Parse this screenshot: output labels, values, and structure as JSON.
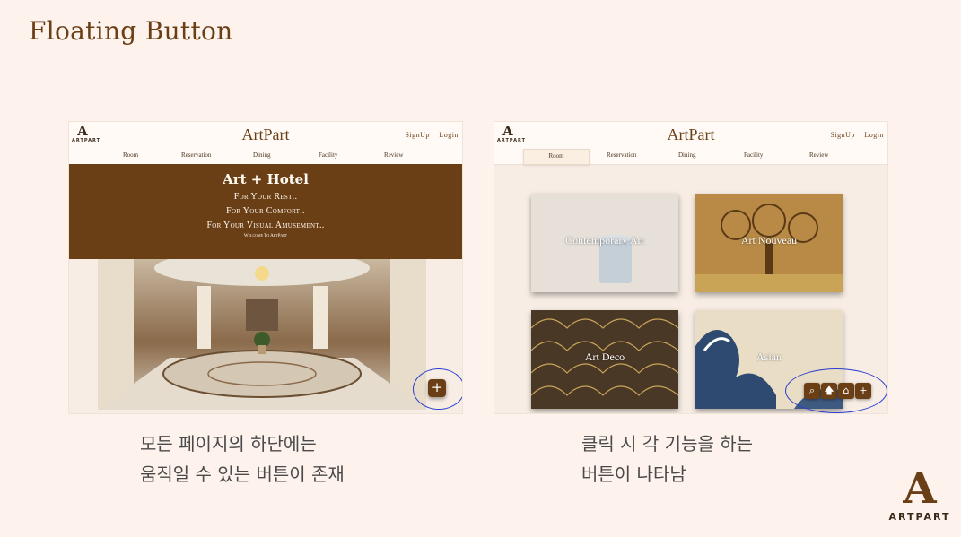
{
  "slide": {
    "title": "Floating Button",
    "caption_left": [
      "모든 페이지의 하단에는",
      "움직일 수 있는 버튼이 존재"
    ],
    "caption_right": [
      "클릭 시 각 기능을 하는",
      "버튼이 나타남"
    ],
    "logo_text": "ARTPART",
    "accent_color": "#6b3f16",
    "highlight_color": "#2a3ecf"
  },
  "site": {
    "logo_mark": "A",
    "logo_text": "ARTPART",
    "brand": "ArtPart",
    "signup": "SignUp",
    "login": "Login",
    "nav": [
      "Room",
      "Reservation",
      "Dining",
      "Facility",
      "Review"
    ]
  },
  "home": {
    "hero_title": "Art + Hotel",
    "hero_lines": [
      "For Your Rest..",
      "For Your Comfort..",
      "For Your Visual Amusement.."
    ],
    "hero_small": "Welcome To ArtPart",
    "fab_icon": "plus-icon",
    "fab_symbol": "+"
  },
  "room": {
    "active_nav": "Room",
    "cards": [
      "Contemporary Art",
      "Art Nouveau",
      "Art Deco",
      "Asian"
    ],
    "fab_icons": [
      "search-icon",
      "arrow-up-icon",
      "home-icon",
      "plus-icon"
    ],
    "fab_symbols": [
      "⌕",
      "🡅",
      "⌂",
      "+"
    ]
  }
}
